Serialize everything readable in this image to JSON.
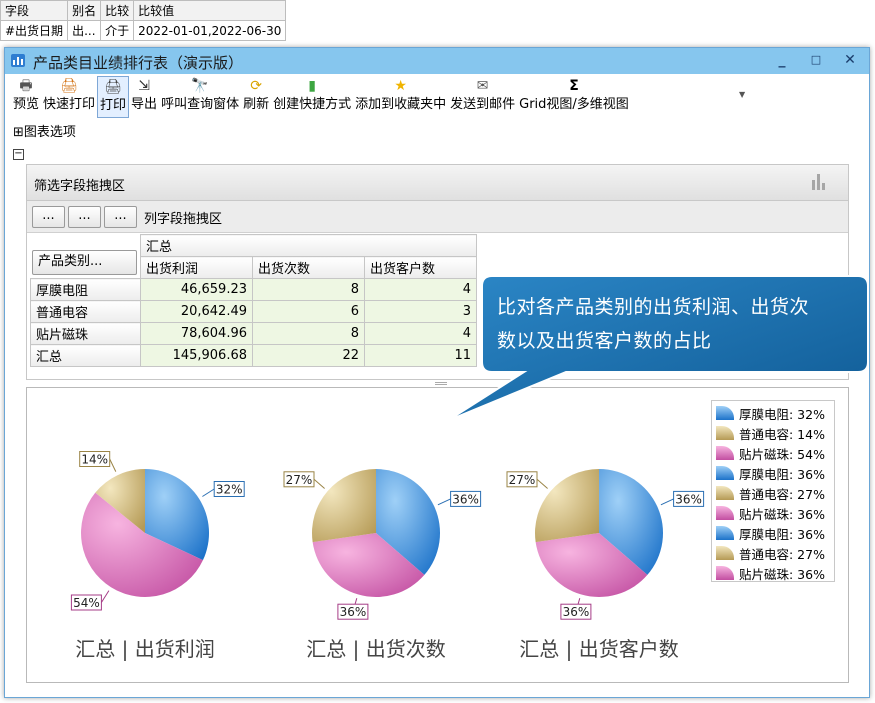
{
  "condition": {
    "headers": [
      "字段",
      "别名",
      "比较",
      "比较值"
    ],
    "row": [
      "#出货日期",
      "出...",
      "介于",
      "2022-01-01,2022-06-30"
    ]
  },
  "window": {
    "title": "产品类目业绩排行表（演示版）",
    "minimize": "_",
    "maximize": "□",
    "close": "✕"
  },
  "toolbar": [
    {
      "label": "预览",
      "icon": "🖶"
    },
    {
      "label": "快速打印",
      "icon": "🖨"
    },
    {
      "label": "打印",
      "icon": "🖨"
    },
    {
      "label": "导出",
      "icon": "⇲"
    },
    {
      "label": "呼叫查询窗体",
      "icon": "🔭"
    },
    {
      "label": "刷新",
      "icon": "⟳"
    },
    {
      "label": "创建快捷方式",
      "icon": "▮"
    },
    {
      "label": "添加到收藏夹中",
      "icon": "★"
    },
    {
      "label": "发送到邮件",
      "icon": "✉"
    },
    {
      "label": "Grid视图/多维视图",
      "icon": "Σ"
    }
  ],
  "chart_options": "⊞图表选项",
  "pivot": {
    "filter_area": "筛选字段拖拽区",
    "col_area": "列字段拖拽区",
    "dots": "...",
    "row_field": "产品类别...",
    "group": "汇总",
    "columns": [
      "出货利润",
      "出货次数",
      "出货客户数"
    ],
    "rows": [
      {
        "name": "厚膜电阻",
        "values": [
          "46,659.23",
          "8",
          "4"
        ]
      },
      {
        "name": "普通电容",
        "values": [
          "20,642.49",
          "6",
          "3"
        ]
      },
      {
        "name": "贴片磁珠",
        "values": [
          "78,604.96",
          "8",
          "4"
        ]
      },
      {
        "name": "汇总",
        "values": [
          "145,906.68",
          "22",
          "11"
        ]
      }
    ]
  },
  "callout": {
    "line1": "比对各产品类别的出货利润、出货次",
    "line2": "数以及出货客户数的占比"
  },
  "colors": {
    "厚膜电阻": "#3d8fdb",
    "普通电容": "#cbb67f",
    "贴片磁珠": "#d567b4"
  },
  "chart_data": [
    {
      "type": "pie",
      "title": "汇总 | 出货利润",
      "categories": [
        "厚膜电阻",
        "普通电容",
        "贴片磁珠"
      ],
      "values": [
        46659.23,
        20642.49,
        78604.96
      ],
      "labels": [
        "32%",
        "14%",
        "54%"
      ]
    },
    {
      "type": "pie",
      "title": "汇总 | 出货次数",
      "categories": [
        "厚膜电阻",
        "普通电容",
        "贴片磁珠"
      ],
      "values": [
        8,
        6,
        8
      ],
      "labels": [
        "36%",
        "27%",
        "36%"
      ]
    },
    {
      "type": "pie",
      "title": "汇总 | 出货客户数",
      "categories": [
        "厚膜电阻",
        "普通电容",
        "贴片磁珠"
      ],
      "values": [
        4,
        3,
        4
      ],
      "labels": [
        "36%",
        "27%",
        "36%"
      ]
    }
  ],
  "legend": [
    {
      "text": "厚膜电阻: 32%",
      "color": "#3d8fdb"
    },
    {
      "text": "普通电容: 14%",
      "color": "#cbb67f"
    },
    {
      "text": "贴片磁珠: 54%",
      "color": "#d567b4"
    },
    {
      "text": "厚膜电阻: 36%",
      "color": "#3d8fdb"
    },
    {
      "text": "普通电容: 27%",
      "color": "#cbb67f"
    },
    {
      "text": "贴片磁珠: 36%",
      "color": "#d567b4"
    },
    {
      "text": "厚膜电阻: 36%",
      "color": "#3d8fdb"
    },
    {
      "text": "普通电容: 27%",
      "color": "#cbb67f"
    },
    {
      "text": "贴片磁珠: 36%",
      "color": "#d567b4"
    }
  ]
}
